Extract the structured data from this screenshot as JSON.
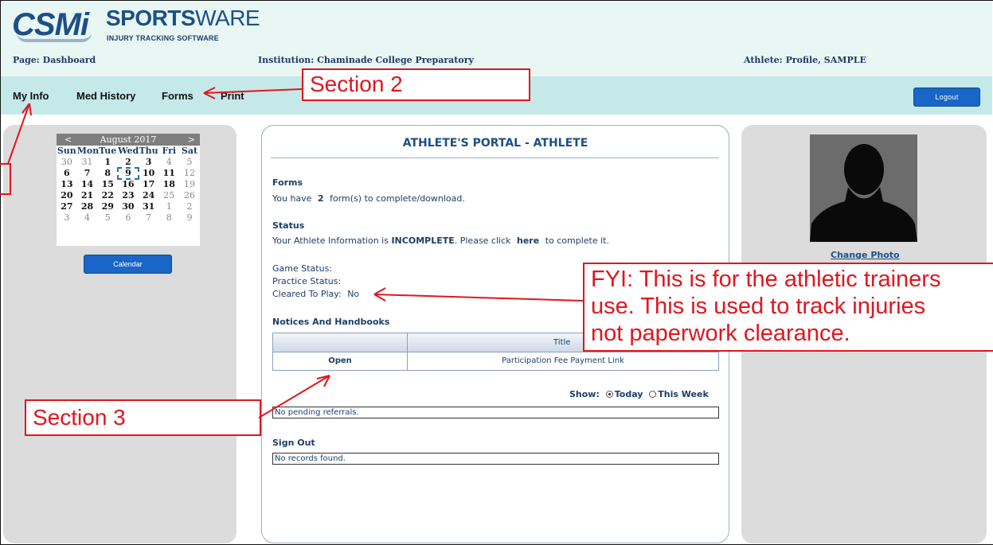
{
  "header": {
    "logo_csmi": "CSMi",
    "logo_sports": "SPORTS",
    "logo_ware": "WARE",
    "logo_tagline": "INJURY TRACKING SOFTWARE",
    "page_label": "Page: Dashboard",
    "institution_label": "Institution: Chaminade College Preparatory",
    "athlete_label": "Athlete: Profile, SAMPLE"
  },
  "nav": {
    "items": [
      "My Info",
      "Med History",
      "Forms",
      "Print"
    ],
    "logout_label": "Logout"
  },
  "calendar": {
    "prev": "<",
    "next": ">",
    "month_label": "August 2017",
    "days_of_week": [
      "Sun",
      "Mon",
      "Tue",
      "Wed",
      "Thu",
      "Fri",
      "Sat"
    ],
    "weeks": [
      [
        "30",
        "31",
        "1",
        "2",
        "3",
        "4",
        "5"
      ],
      [
        "6",
        "7",
        "8",
        "9",
        "10",
        "11",
        "12"
      ],
      [
        "13",
        "14",
        "15",
        "16",
        "17",
        "18",
        "19"
      ],
      [
        "20",
        "21",
        "22",
        "23",
        "24",
        "25",
        "26"
      ],
      [
        "27",
        "28",
        "29",
        "30",
        "31",
        "1",
        "2"
      ],
      [
        "3",
        "4",
        "5",
        "6",
        "7",
        "8",
        "9"
      ]
    ],
    "today": "9",
    "button_label": "Calendar"
  },
  "portal": {
    "title": "ATHLETE'S PORTAL - ATHLETE",
    "forms_heading": "Forms",
    "forms_text_prefix": "You have",
    "forms_count": "2",
    "forms_text_suffix": "form(s) to complete/download.",
    "status_heading": "Status",
    "status_prefix": "Your Athlete Information is",
    "status_value": "INCOMPLETE",
    "status_middle": ". Please click",
    "status_link": "here",
    "status_suffix": "to complete it.",
    "game_status_label": "Game Status:",
    "practice_status_label": "Practice Status:",
    "cleared_label": "Cleared To Play:",
    "cleared_value": "No",
    "notices_heading": "Notices And Handbooks",
    "table_header_title": "Title",
    "table_open": "Open",
    "table_row_title": "Participation Fee Payment Link",
    "show_label": "Show:",
    "show_today": "Today",
    "show_week": "This Week",
    "referrals_text": "No pending referrals.",
    "signout_heading": "Sign Out",
    "signout_text": "No records found."
  },
  "profile": {
    "change_photo": "Change Photo"
  },
  "annotations": {
    "section2": "Section 2",
    "section3": "Section 3",
    "fyi_line1": "FYI: This is for the athletic trainers",
    "fyi_line2": "use. This is used to track injuries",
    "fyi_line3": "not paperwork clearance."
  },
  "colors": {
    "header_bg": "#e8f6f4",
    "nav_bg": "#c5e9e8",
    "button_blue": "#1966c8",
    "panel_gray": "#dcdcdc",
    "annotation_red": "#e0161e"
  }
}
